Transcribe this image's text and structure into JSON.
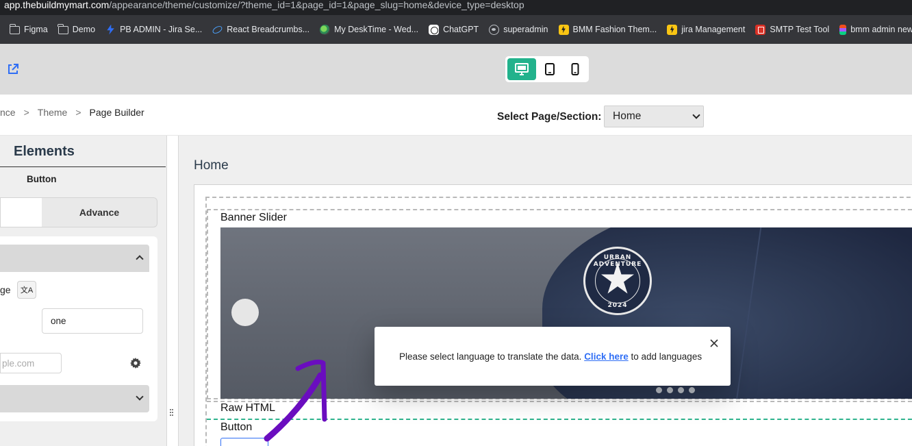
{
  "browser": {
    "url_host": "app.thebuildmymart.com",
    "url_path": "/appearance/theme/customize/?theme_id=1&page_id=1&page_slug=home&device_type=desktop"
  },
  "bookmarks": [
    {
      "label": "Figma",
      "icon": "folder-icon"
    },
    {
      "label": "Demo",
      "icon": "folder-icon"
    },
    {
      "label": "PB ADMIN  - Jira Se...",
      "icon": "jira-icon"
    },
    {
      "label": "React Breadcrumbs...",
      "icon": "react-icon"
    },
    {
      "label": "My DeskTime - Wed...",
      "icon": "desktime-icon"
    },
    {
      "label": "ChatGPT",
      "icon": "chatgpt-icon"
    },
    {
      "label": "superadmin",
      "icon": "globe-icon"
    },
    {
      "label": "BMM Fashion Them...",
      "icon": "bolt-icon"
    },
    {
      "label": "jira Management",
      "icon": "bolt-icon"
    },
    {
      "label": "SMTP Test Tool",
      "icon": "smtp-icon"
    },
    {
      "label": "bmm admin new -...",
      "icon": "figma-icon"
    }
  ],
  "header": {
    "devices": [
      "desktop",
      "tablet",
      "mobile"
    ],
    "active_device": "desktop",
    "accent_color": "#22b28c"
  },
  "breadcrumb": {
    "items": [
      "nce",
      "Theme",
      "Page Builder"
    ],
    "separator": ">"
  },
  "page_selector": {
    "label": "Select Page/Section:",
    "value": "Home"
  },
  "left_panel": {
    "title": "Elements",
    "subtitle": "Button",
    "tabs": [
      "",
      "Advance"
    ],
    "language_label": "ge",
    "translate_icon": "文A",
    "text_value": "one",
    "url_placeholder": "ple.com"
  },
  "canvas": {
    "page_title": "Home",
    "sections": [
      "Banner Slider",
      "Raw HTML",
      "Button"
    ],
    "banner": {
      "badge_top": "URBAN ADVENTURE",
      "badge_year": "2024",
      "slide_count": 4
    }
  },
  "toast": {
    "message_before": "Please select language to translate the data. ",
    "link_text": "Click here",
    "message_after": " to add languages",
    "link_color": "#2f6ef5"
  }
}
